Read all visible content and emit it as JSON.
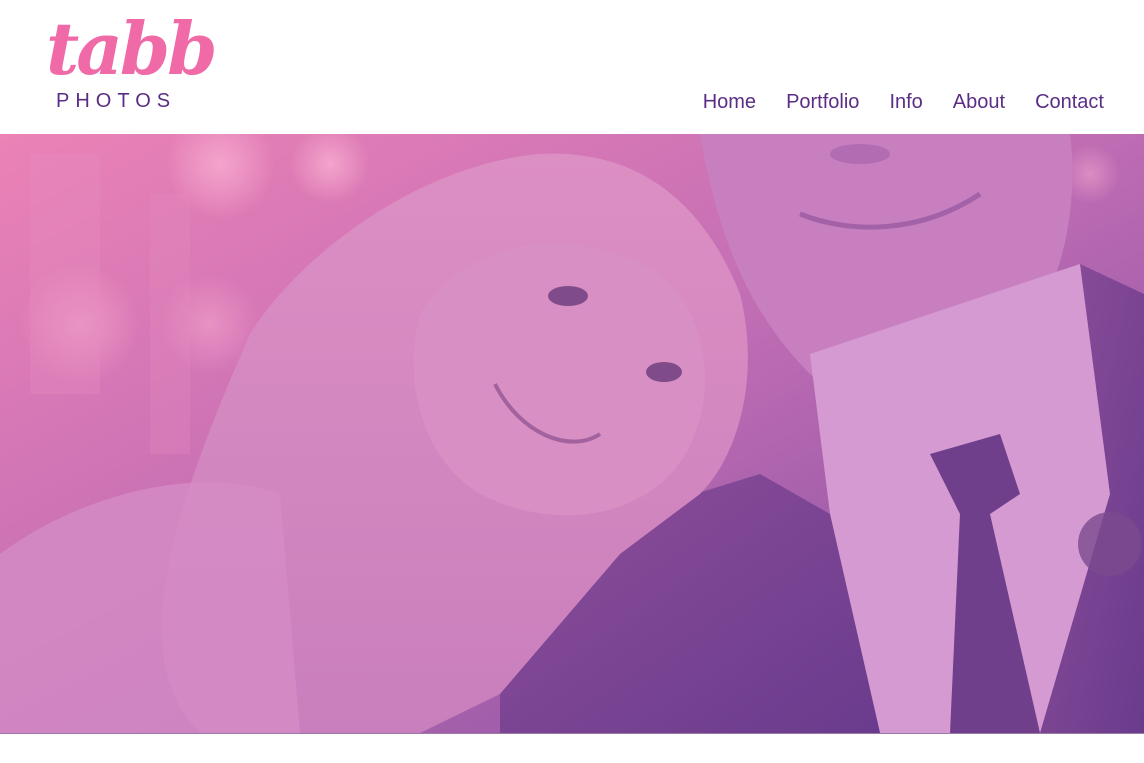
{
  "logo": {
    "script_text": "tabb",
    "sub_text": "PHOTOS"
  },
  "nav": {
    "items": [
      {
        "label": "Home"
      },
      {
        "label": "Portfolio"
      },
      {
        "label": "Info"
      },
      {
        "label": "About"
      },
      {
        "label": "Contact"
      }
    ]
  },
  "colors": {
    "logo_pink": "#f06aa8",
    "nav_purple": "#5b2d86",
    "hero_pink": "#e87ab0",
    "hero_purple": "#7a4a9c"
  }
}
